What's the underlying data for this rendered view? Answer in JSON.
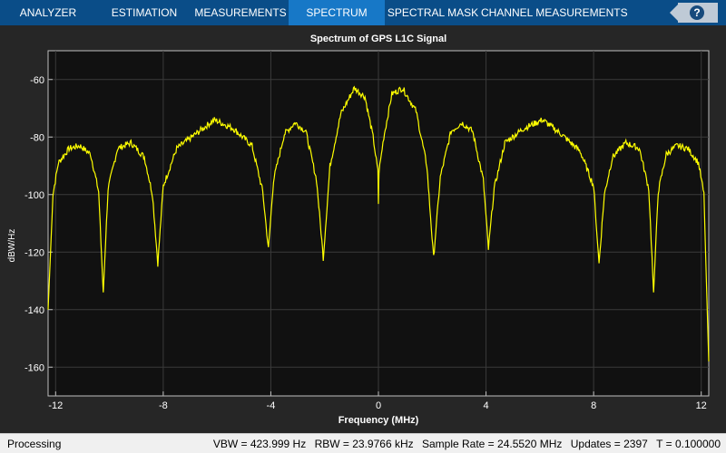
{
  "toolstrip": {
    "tabs": [
      {
        "label": "ANALYZER",
        "active": false
      },
      {
        "label": "ESTIMATION",
        "active": false
      },
      {
        "label": "MEASUREMENTS",
        "active": false
      },
      {
        "label": "SPECTRUM",
        "active": true
      },
      {
        "label": "SPECTRAL MASK",
        "active": false
      },
      {
        "label": "CHANNEL MEASUREMENTS",
        "active": false
      }
    ],
    "help_icon": "help-question-icon",
    "help_text": "?"
  },
  "chart_data": {
    "type": "line",
    "title": "Spectrum of GPS L1C Signal",
    "xlabel": "Frequency (MHz)",
    "ylabel": "dBW/Hz",
    "xlim": [
      -12.28,
      12.28
    ],
    "ylim": [
      -170,
      -50
    ],
    "xticks": [
      -12,
      -8,
      -4,
      0,
      4,
      8,
      12
    ],
    "yticks": [
      -160,
      -140,
      -120,
      -100,
      -80,
      -60
    ],
    "grid": true,
    "line_color": "#ffff00",
    "series": [
      {
        "x": [
          -12.28,
          -12.1,
          -11.9,
          -11.5,
          -11.1,
          -10.7,
          -10.4,
          -10.23,
          -10.05,
          -9.7,
          -9.2,
          -8.7,
          -8.4,
          -8.2,
          -8.0,
          -7.5,
          -6.8,
          -6.1,
          -5.4,
          -4.7,
          -4.3,
          -4.09,
          -3.9,
          -3.5,
          -3.1,
          -2.7,
          -2.3,
          -2.05,
          -1.8,
          -1.4,
          -0.9,
          -0.5,
          -0.2,
          -0.02,
          0.0,
          0.02,
          0.2,
          0.5,
          0.9,
          1.4,
          1.8,
          2.05,
          2.3,
          2.7,
          3.1,
          3.5,
          3.9,
          4.09,
          4.3,
          4.7,
          5.4,
          6.1,
          6.8,
          7.5,
          8.0,
          8.2,
          8.4,
          8.7,
          9.2,
          9.7,
          10.05,
          10.23,
          10.4,
          10.7,
          11.1,
          11.5,
          11.9,
          12.1,
          12.28
        ],
        "y": [
          -140,
          -100,
          -89,
          -84,
          -83,
          -86,
          -99,
          -134,
          -98,
          -84,
          -82,
          -87,
          -100,
          -124,
          -97,
          -84,
          -79,
          -74,
          -77,
          -83,
          -99,
          -119,
          -95,
          -79,
          -75,
          -78,
          -95,
          -122,
          -90,
          -72,
          -63,
          -66,
          -80,
          -92,
          -103,
          -92,
          -80,
          -65,
          -63,
          -71,
          -90,
          -122,
          -94,
          -78,
          -75,
          -78,
          -95,
          -119,
          -98,
          -82,
          -77,
          -74,
          -79,
          -85,
          -97,
          -124,
          -100,
          -87,
          -82,
          -84,
          -98,
          -134,
          -99,
          -86,
          -83,
          -84,
          -89,
          -100,
          -158
        ]
      }
    ]
  },
  "status": {
    "left": "Processing",
    "right": [
      "VBW = 423.999 Hz",
      "RBW = 23.9766 kHz",
      "Sample Rate = 24.5520 MHz",
      "Updates = 2397",
      "T = 0.100000"
    ]
  }
}
